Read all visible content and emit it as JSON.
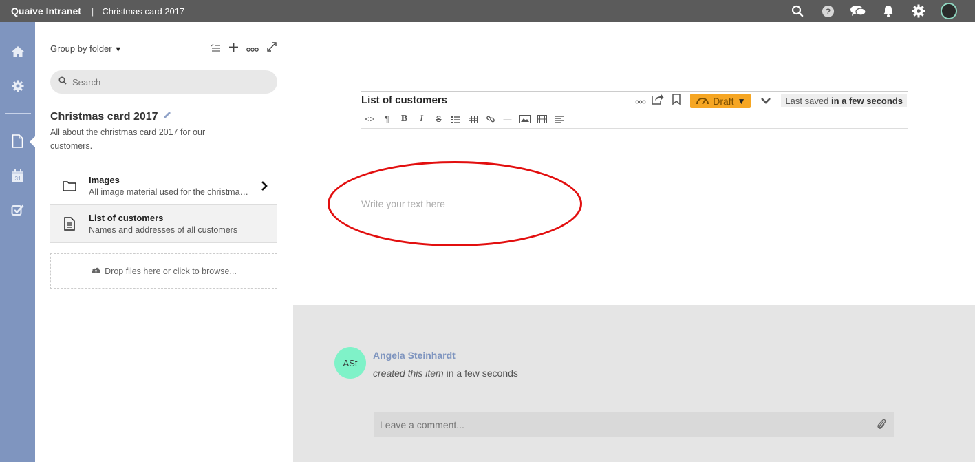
{
  "topbar": {
    "brand": "Quaive Intranet",
    "separator": "|",
    "breadcrumb": "Christmas card 2017",
    "icons": [
      "search-icon",
      "help-icon",
      "chat-icon",
      "bell-icon",
      "gear-icon",
      "user-avatar"
    ]
  },
  "rail": {
    "icons": [
      "home-icon",
      "gear-icon",
      "document-icon",
      "calendar-icon",
      "checkbox-icon"
    ],
    "calendar_day": "31"
  },
  "sidebar": {
    "group_by": "Group by folder",
    "search_placeholder": "Search",
    "workspace_title": "Christmas card 2017",
    "workspace_description": "All about the christmas card 2017 for our customers.",
    "items": [
      {
        "title": "Images",
        "subtitle": "All image material used for the christmas card",
        "icon": "folder-icon"
      },
      {
        "title": "List of customers",
        "subtitle": "Names and addresses of all customers",
        "icon": "document-icon"
      }
    ],
    "drop_text": "Drop files here or click to browse..."
  },
  "editor": {
    "title": "List of customers",
    "status": "Draft",
    "saved_prefix": "Last saved",
    "saved_time": "in a few seconds",
    "placeholder": "Write your text here",
    "format_buttons": [
      "<>",
      "¶",
      "B",
      "I",
      "S",
      "list",
      "table",
      "link",
      "—",
      "image",
      "video",
      "align"
    ]
  },
  "activity": {
    "avatar_initials": "ASt",
    "author": "Angela Steinhardt",
    "action": "created this item",
    "time": "in a few seconds",
    "comment_placeholder": "Leave a comment..."
  },
  "colors": {
    "topbar": "#5b5b5b",
    "rail": "#7f95bf",
    "draft": "#f6a623",
    "avatar": "#7ff2c8",
    "annotation": "#e20f0f"
  }
}
